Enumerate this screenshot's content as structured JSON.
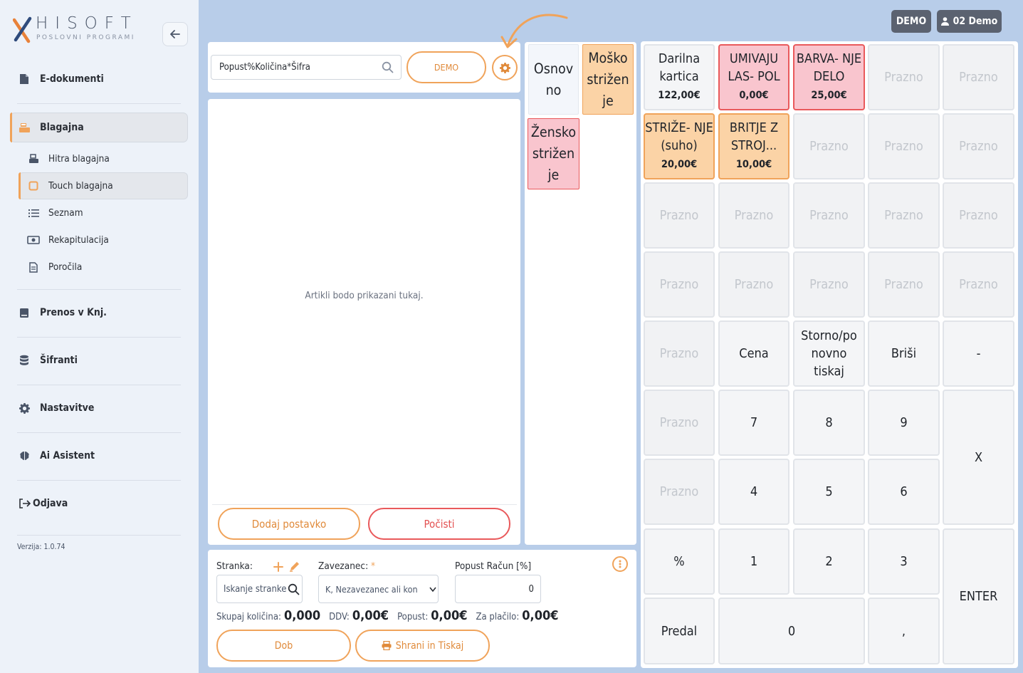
{
  "brand": {
    "name": "HISOFT",
    "tagline": "POSLOVNI PROGRAMI"
  },
  "sidebar": {
    "items": [
      {
        "label": "E-dokumenti"
      },
      {
        "label": "Blagajna"
      },
      {
        "label": "Prenos v Knj."
      },
      {
        "label": "Šifranti"
      },
      {
        "label": "Nastavitve"
      },
      {
        "label": "Ai Asistent"
      },
      {
        "label": "Odjava"
      }
    ],
    "subitems": [
      {
        "label": "Hitra blagajna"
      },
      {
        "label": "Touch blagajna"
      },
      {
        "label": "Seznam"
      },
      {
        "label": "Rekapitulacija"
      },
      {
        "label": "Poročila"
      }
    ],
    "version": "Verzija: 1.0.74"
  },
  "topbar": {
    "company": "DEMO",
    "user": "02 Demo"
  },
  "order": {
    "search_value": "Popust%Količina*Šifra",
    "demo_label": "DEMO",
    "empty_message": "Artikli bodo prikazani tukaj.",
    "add_item_label": "Dodaj postavko",
    "clear_label": "Počisti"
  },
  "customer": {
    "customer_label": "Stranka:",
    "customer_placeholder": "Iskanje stranke",
    "taxpayer_label": "Zavezanec:",
    "required_mark": "*",
    "taxpayer_value": "K, Nezavezanec ali kon",
    "discount_label": "Popust Račun [%]",
    "discount_value": "0",
    "total_qty_label": "Skupaj količina:",
    "total_qty": "0,000",
    "vat_label": "DDV:",
    "vat": "0,00€",
    "discount_total_label": "Popust:",
    "discount_total": "0,00€",
    "pay_label": "Za plačilo:",
    "pay": "0,00€",
    "dob_label": "Dob",
    "save_print_label": "Shrani in Tiskaj"
  },
  "categories": [
    {
      "label": "Osnov no"
    },
    {
      "label": "Moško strižen je"
    },
    {
      "label": "Žensko strižen je"
    }
  ],
  "keypad": {
    "products": [
      {
        "label": "Darilna kartica",
        "price": "122,00€"
      },
      {
        "label": "UMIVAJU LAS- POL",
        "price": "0,00€"
      },
      {
        "label": "BARVA- NJE DELO",
        "price": "25,00€"
      },
      {
        "label": "STRIŽE- NJE (suho)",
        "price": "20,00€"
      },
      {
        "label": "BRITJE Z STROJ...",
        "price": "10,00€"
      }
    ],
    "empty_label": "Prazno",
    "cena": "Cena",
    "storno": "Storno/po novno tiskaj",
    "brisi": "Briši",
    "minus": "-",
    "d7": "7",
    "d8": "8",
    "d9": "9",
    "d4": "4",
    "d5": "5",
    "d6": "6",
    "d1": "1",
    "d2": "2",
    "d3": "3",
    "d0": "0",
    "multiply": "X",
    "percent": "%",
    "enter": "ENTER",
    "predal": "Predal",
    "comma": ","
  },
  "colors": {
    "accent_orange": "#f0a35a",
    "accent_red": "#e9595b",
    "background": "#b8cde9"
  }
}
